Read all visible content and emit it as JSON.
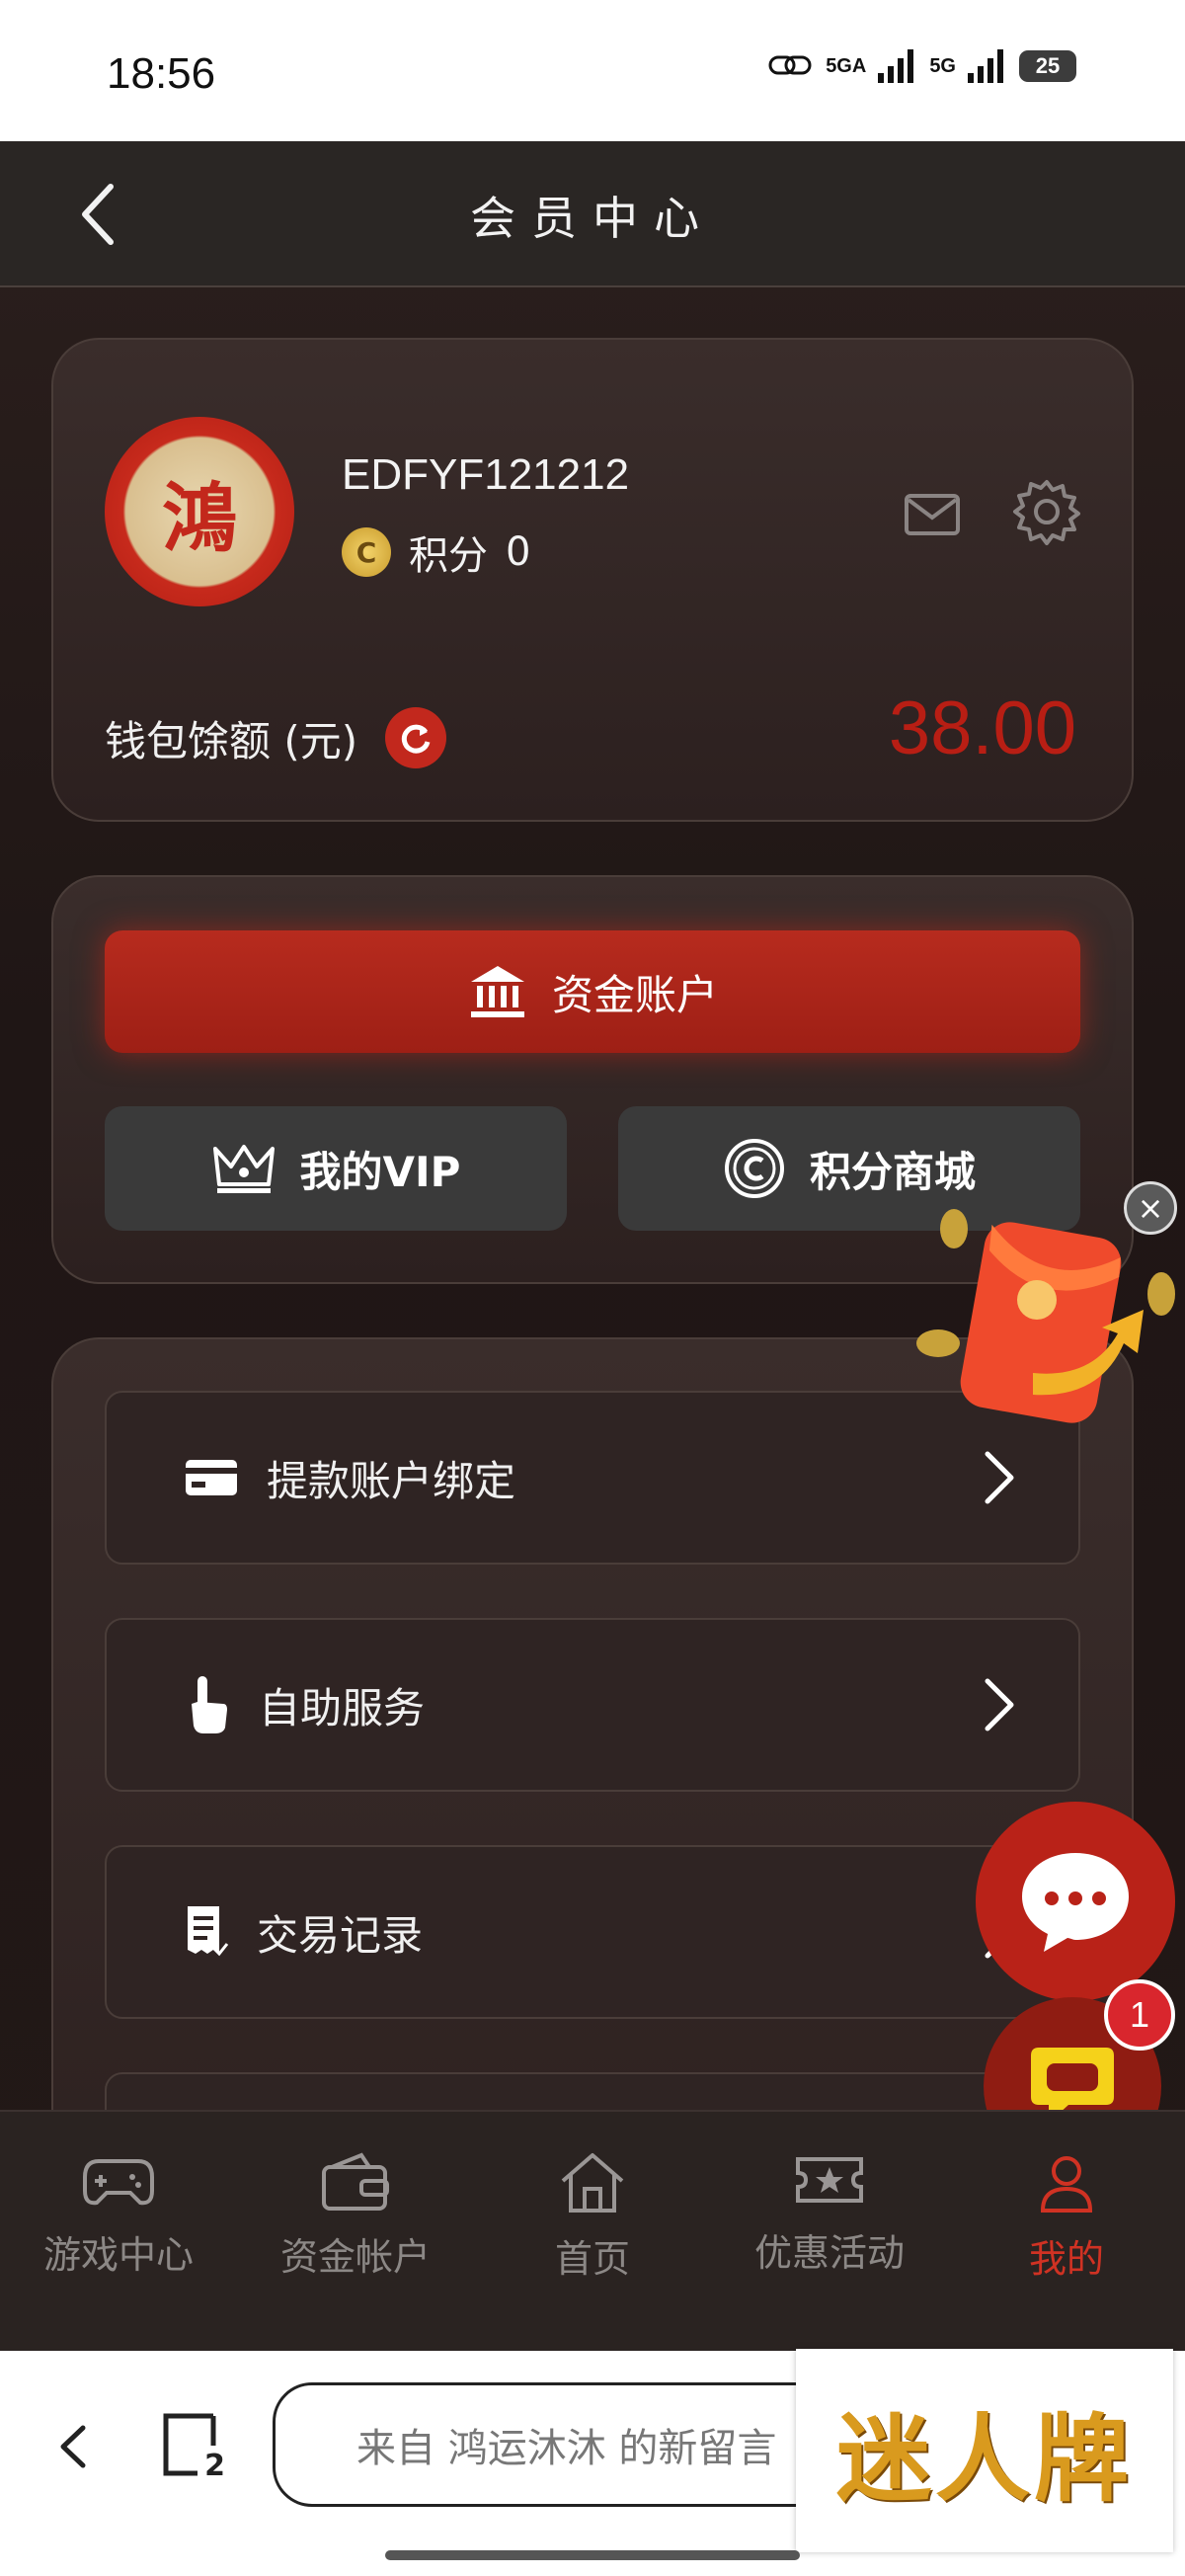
{
  "status_bar": {
    "time": "18:56",
    "network1": "5GA",
    "network2": "5G",
    "battery": "25"
  },
  "nav": {
    "title": "会员中心"
  },
  "profile": {
    "avatar_char": "鴻",
    "username": "EDFYF121212",
    "points_label": "积分",
    "points_value": "0",
    "coin_char": "C"
  },
  "wallet": {
    "label": "钱包馀额 (元)",
    "balance": "38.00",
    "balance_color": "#b81e14"
  },
  "actions": {
    "fund_account": "资金账户",
    "vip": "我的VIP",
    "points_shop": "积分商城"
  },
  "menu": [
    {
      "label": "提款账户绑定",
      "icon": "card-icon"
    },
    {
      "label": "自助服务",
      "icon": "hand-pointer-icon"
    },
    {
      "label": "交易记录",
      "icon": "receipt-icon"
    },
    {
      "label": "",
      "icon": ""
    }
  ],
  "tabs": [
    {
      "label": "游戏中心",
      "icon": "gamepad-icon"
    },
    {
      "label": "资金帐户",
      "icon": "wallet-icon"
    },
    {
      "label": "首页",
      "icon": "home-icon"
    },
    {
      "label": "优惠活动",
      "icon": "ticket-icon"
    },
    {
      "label": "我的",
      "icon": "user-icon",
      "active": true
    }
  ],
  "chat_badge": "1",
  "browser": {
    "tab_count": "2",
    "url_text": "来自 鸿运沐沐 的新留言"
  },
  "ad": {
    "text": "迷人牌"
  },
  "colors": {
    "accent_red": "#b72b1e",
    "background": "#1f1615"
  }
}
